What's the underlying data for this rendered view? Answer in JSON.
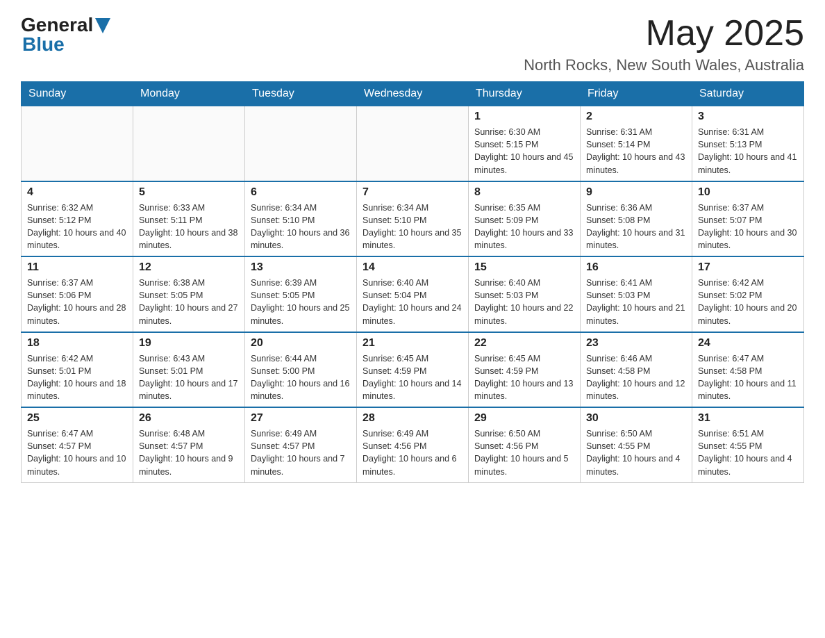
{
  "header": {
    "logo_general": "General",
    "logo_blue": "Blue",
    "month_year": "May 2025",
    "location": "North Rocks, New South Wales, Australia"
  },
  "days_of_week": [
    "Sunday",
    "Monday",
    "Tuesday",
    "Wednesday",
    "Thursday",
    "Friday",
    "Saturday"
  ],
  "weeks": [
    [
      {
        "day": "",
        "info": ""
      },
      {
        "day": "",
        "info": ""
      },
      {
        "day": "",
        "info": ""
      },
      {
        "day": "",
        "info": ""
      },
      {
        "day": "1",
        "info": "Sunrise: 6:30 AM\nSunset: 5:15 PM\nDaylight: 10 hours and 45 minutes."
      },
      {
        "day": "2",
        "info": "Sunrise: 6:31 AM\nSunset: 5:14 PM\nDaylight: 10 hours and 43 minutes."
      },
      {
        "day": "3",
        "info": "Sunrise: 6:31 AM\nSunset: 5:13 PM\nDaylight: 10 hours and 41 minutes."
      }
    ],
    [
      {
        "day": "4",
        "info": "Sunrise: 6:32 AM\nSunset: 5:12 PM\nDaylight: 10 hours and 40 minutes."
      },
      {
        "day": "5",
        "info": "Sunrise: 6:33 AM\nSunset: 5:11 PM\nDaylight: 10 hours and 38 minutes."
      },
      {
        "day": "6",
        "info": "Sunrise: 6:34 AM\nSunset: 5:10 PM\nDaylight: 10 hours and 36 minutes."
      },
      {
        "day": "7",
        "info": "Sunrise: 6:34 AM\nSunset: 5:10 PM\nDaylight: 10 hours and 35 minutes."
      },
      {
        "day": "8",
        "info": "Sunrise: 6:35 AM\nSunset: 5:09 PM\nDaylight: 10 hours and 33 minutes."
      },
      {
        "day": "9",
        "info": "Sunrise: 6:36 AM\nSunset: 5:08 PM\nDaylight: 10 hours and 31 minutes."
      },
      {
        "day": "10",
        "info": "Sunrise: 6:37 AM\nSunset: 5:07 PM\nDaylight: 10 hours and 30 minutes."
      }
    ],
    [
      {
        "day": "11",
        "info": "Sunrise: 6:37 AM\nSunset: 5:06 PM\nDaylight: 10 hours and 28 minutes."
      },
      {
        "day": "12",
        "info": "Sunrise: 6:38 AM\nSunset: 5:05 PM\nDaylight: 10 hours and 27 minutes."
      },
      {
        "day": "13",
        "info": "Sunrise: 6:39 AM\nSunset: 5:05 PM\nDaylight: 10 hours and 25 minutes."
      },
      {
        "day": "14",
        "info": "Sunrise: 6:40 AM\nSunset: 5:04 PM\nDaylight: 10 hours and 24 minutes."
      },
      {
        "day": "15",
        "info": "Sunrise: 6:40 AM\nSunset: 5:03 PM\nDaylight: 10 hours and 22 minutes."
      },
      {
        "day": "16",
        "info": "Sunrise: 6:41 AM\nSunset: 5:03 PM\nDaylight: 10 hours and 21 minutes."
      },
      {
        "day": "17",
        "info": "Sunrise: 6:42 AM\nSunset: 5:02 PM\nDaylight: 10 hours and 20 minutes."
      }
    ],
    [
      {
        "day": "18",
        "info": "Sunrise: 6:42 AM\nSunset: 5:01 PM\nDaylight: 10 hours and 18 minutes."
      },
      {
        "day": "19",
        "info": "Sunrise: 6:43 AM\nSunset: 5:01 PM\nDaylight: 10 hours and 17 minutes."
      },
      {
        "day": "20",
        "info": "Sunrise: 6:44 AM\nSunset: 5:00 PM\nDaylight: 10 hours and 16 minutes."
      },
      {
        "day": "21",
        "info": "Sunrise: 6:45 AM\nSunset: 4:59 PM\nDaylight: 10 hours and 14 minutes."
      },
      {
        "day": "22",
        "info": "Sunrise: 6:45 AM\nSunset: 4:59 PM\nDaylight: 10 hours and 13 minutes."
      },
      {
        "day": "23",
        "info": "Sunrise: 6:46 AM\nSunset: 4:58 PM\nDaylight: 10 hours and 12 minutes."
      },
      {
        "day": "24",
        "info": "Sunrise: 6:47 AM\nSunset: 4:58 PM\nDaylight: 10 hours and 11 minutes."
      }
    ],
    [
      {
        "day": "25",
        "info": "Sunrise: 6:47 AM\nSunset: 4:57 PM\nDaylight: 10 hours and 10 minutes."
      },
      {
        "day": "26",
        "info": "Sunrise: 6:48 AM\nSunset: 4:57 PM\nDaylight: 10 hours and 9 minutes."
      },
      {
        "day": "27",
        "info": "Sunrise: 6:49 AM\nSunset: 4:57 PM\nDaylight: 10 hours and 7 minutes."
      },
      {
        "day": "28",
        "info": "Sunrise: 6:49 AM\nSunset: 4:56 PM\nDaylight: 10 hours and 6 minutes."
      },
      {
        "day": "29",
        "info": "Sunrise: 6:50 AM\nSunset: 4:56 PM\nDaylight: 10 hours and 5 minutes."
      },
      {
        "day": "30",
        "info": "Sunrise: 6:50 AM\nSunset: 4:55 PM\nDaylight: 10 hours and 4 minutes."
      },
      {
        "day": "31",
        "info": "Sunrise: 6:51 AM\nSunset: 4:55 PM\nDaylight: 10 hours and 4 minutes."
      }
    ]
  ]
}
